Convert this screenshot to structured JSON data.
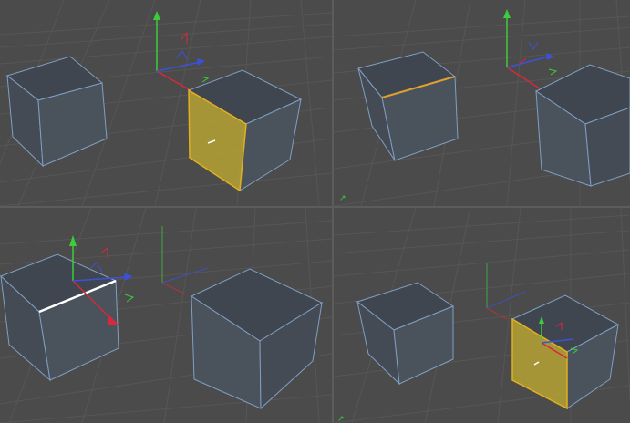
{
  "colors": {
    "viewport_bg": "#4b4b4b",
    "grid_line": "#565656",
    "grid_line_major": "#5e5e5e",
    "cube_top": "#404650",
    "cube_front": "#4a525c",
    "cube_side": "#444b55",
    "cube_edge": "#7f9fc2",
    "selected_face": "#b6a233",
    "selected_face_edge": "#e0b020",
    "selected_edge_orange": "#e0a030",
    "selected_edge_white": "#ffffff",
    "axis_x": "#d8283c",
    "axis_y": "#3ccc3c",
    "axis_z": "#3b52d8"
  },
  "viewports": [
    {
      "id": "top-left",
      "mode": "polygon",
      "selected": "face"
    },
    {
      "id": "top-right",
      "mode": "edge",
      "selected": "edge-orange"
    },
    {
      "id": "bottom-left",
      "mode": "edge",
      "selected": "edge-white"
    },
    {
      "id": "bottom-right",
      "mode": "polygon",
      "selected": "face"
    }
  ]
}
